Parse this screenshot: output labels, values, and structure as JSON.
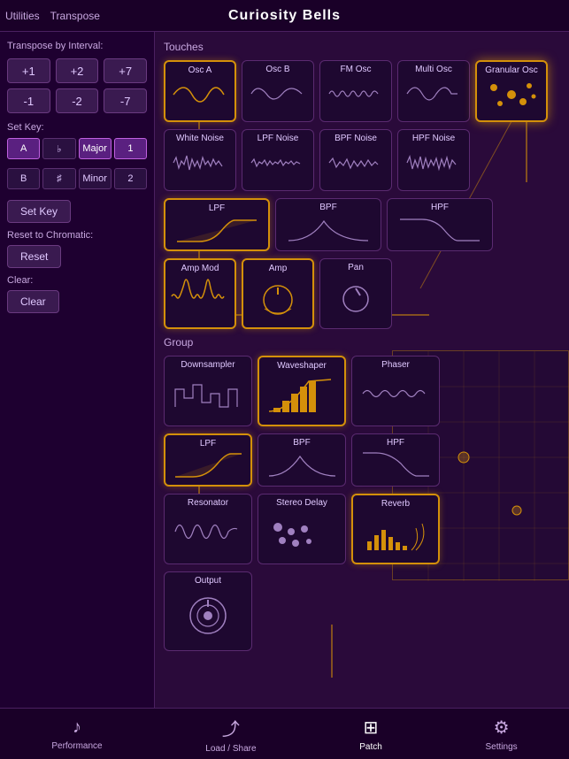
{
  "header": {
    "title": "Curiosity Bells",
    "nav_left": [
      "Utilities",
      "Transpose"
    ]
  },
  "left_panel": {
    "transpose_label": "Transpose by Interval:",
    "intervals_pos": [
      "+1",
      "+2",
      "+7"
    ],
    "intervals_neg": [
      "-1",
      "-2",
      "-7"
    ],
    "set_key_label": "Set Key:",
    "keys_row1": [
      "A",
      "♭",
      "Major",
      "1"
    ],
    "keys_row2": [
      "B",
      "♯",
      "Minor",
      "2"
    ],
    "set_key_btn": "Set Key",
    "reset_label": "Reset to Chromatic:",
    "reset_btn": "Reset",
    "clear_label": "Clear:",
    "clear_btn": "Clear"
  },
  "touches": {
    "section_label": "Touches",
    "modules": [
      {
        "id": "osc-a",
        "label": "Osc A",
        "active": true
      },
      {
        "id": "osc-b",
        "label": "Osc B",
        "active": false
      },
      {
        "id": "fm-osc",
        "label": "FM Osc",
        "active": false
      },
      {
        "id": "multi-osc",
        "label": "Multi Osc",
        "active": false
      },
      {
        "id": "granular-osc",
        "label": "Granular Osc",
        "active": true
      },
      {
        "id": "white-noise",
        "label": "White Noise",
        "active": false
      },
      {
        "id": "lpf-noise",
        "label": "LPF Noise",
        "active": false
      },
      {
        "id": "bpf-noise",
        "label": "BPF Noise",
        "active": false
      },
      {
        "id": "hpf-noise",
        "label": "HPF Noise",
        "active": false
      }
    ]
  },
  "filters": {
    "modules": [
      {
        "id": "lpf",
        "label": "LPF",
        "active": true
      },
      {
        "id": "bpf",
        "label": "BPF",
        "active": false
      },
      {
        "id": "hpf",
        "label": "HPF",
        "active": false
      }
    ]
  },
  "amp_section": {
    "modules": [
      {
        "id": "amp-mod",
        "label": "Amp Mod",
        "active": true
      },
      {
        "id": "amp",
        "label": "Amp",
        "active": true
      },
      {
        "id": "pan",
        "label": "Pan",
        "active": false
      }
    ]
  },
  "group": {
    "section_label": "Group",
    "modules": [
      {
        "id": "downsampler",
        "label": "Downsampler",
        "active": false
      },
      {
        "id": "waveshaper",
        "label": "Waveshaper",
        "active": true
      },
      {
        "id": "phaser",
        "label": "Phaser",
        "active": false
      }
    ]
  },
  "group_filters": {
    "modules": [
      {
        "id": "g-lpf",
        "label": "LPF",
        "active": true
      },
      {
        "id": "g-bpf",
        "label": "BPF",
        "active": false
      },
      {
        "id": "g-hpf",
        "label": "HPF",
        "active": false
      }
    ]
  },
  "effects": {
    "modules": [
      {
        "id": "resonator",
        "label": "Resonator",
        "active": false
      },
      {
        "id": "stereo-delay",
        "label": "Stereo Delay",
        "active": false
      },
      {
        "id": "reverb",
        "label": "Reverb",
        "active": true
      }
    ]
  },
  "output": {
    "label": "Output",
    "active": false
  },
  "footer": {
    "items": [
      {
        "id": "performance",
        "label": "Performance",
        "icon": "♪",
        "active": false
      },
      {
        "id": "load-share",
        "label": "Load / Share",
        "icon": "⤴",
        "active": false
      },
      {
        "id": "patch",
        "label": "Patch",
        "icon": "⊞",
        "active": true
      },
      {
        "id": "settings",
        "label": "Settings",
        "icon": "⚙",
        "active": false
      }
    ]
  }
}
